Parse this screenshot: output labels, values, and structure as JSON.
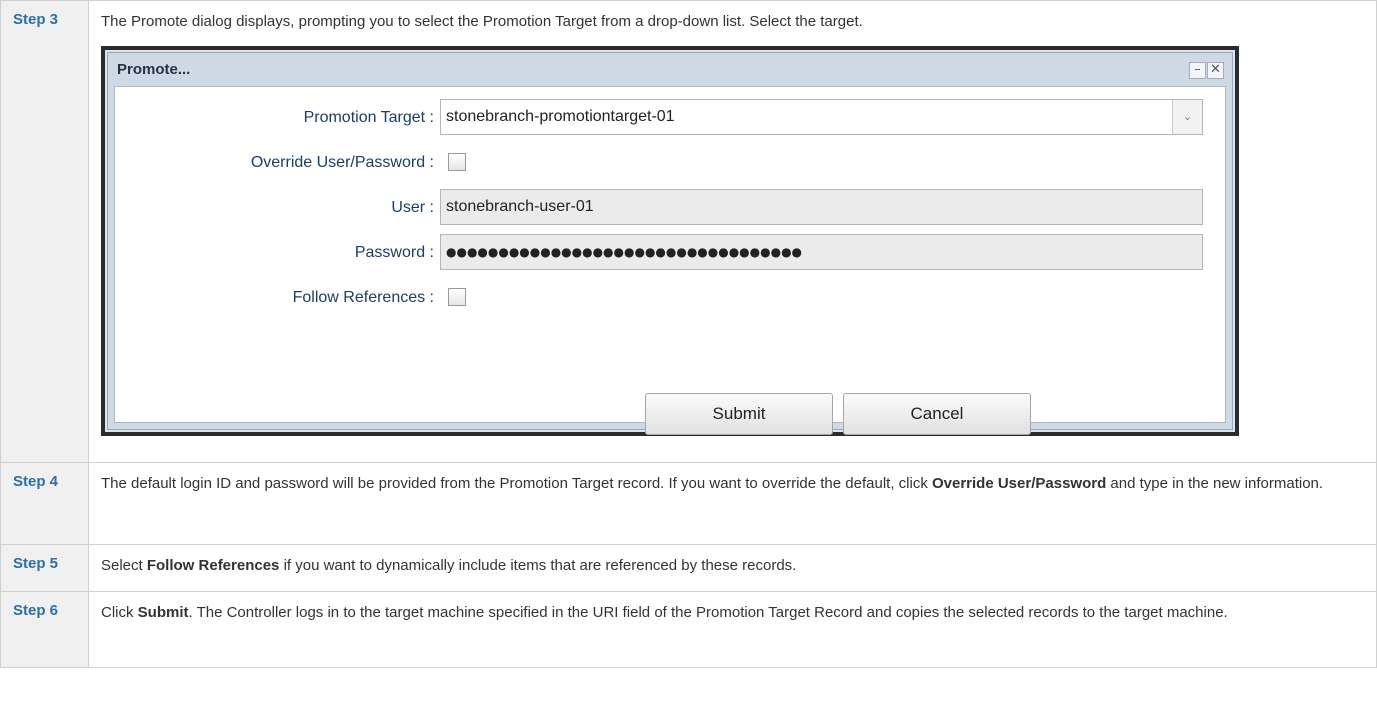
{
  "steps": [
    {
      "label": "Step 3",
      "text": "The Promote dialog displays, prompting you to select the Promotion Target from a drop-down list. Select the target."
    },
    {
      "label": "Step 4",
      "text_a": "The default login ID and password will be provided from the Promotion Target record. If you want to override the default, click ",
      "bold": "Override User/Password",
      "text_b": " and type in the new information."
    },
    {
      "label": "Step 5",
      "text_a": "Select ",
      "bold": "Follow References",
      "text_b": " if you want to dynamically include items that are referenced by these records."
    },
    {
      "label": "Step 6",
      "text_a": "Click ",
      "bold": "Submit",
      "text_b": ". The Controller logs in to the target machine specified in the URI field of the Promotion Target Record and copies the selected records to the target machine."
    }
  ],
  "dialog": {
    "title": "Promote...",
    "minimize_glyph": "–",
    "close_glyph": "✕",
    "promotion_target": {
      "label": "Promotion Target :",
      "value": "stonebranch-promotiontarget-01",
      "arrow_glyph": "⌄"
    },
    "override": {
      "label": "Override User/Password :",
      "checked": false
    },
    "user": {
      "label": "User :",
      "value": "stonebranch-user-01"
    },
    "password": {
      "label": "Password :",
      "value": "●●●●●●●●●●●●●●●●●●●●●●●●●●●●●●●●●●"
    },
    "follow_refs": {
      "label": "Follow References :",
      "checked": false
    },
    "submit_label": "Submit",
    "cancel_label": "Cancel"
  }
}
